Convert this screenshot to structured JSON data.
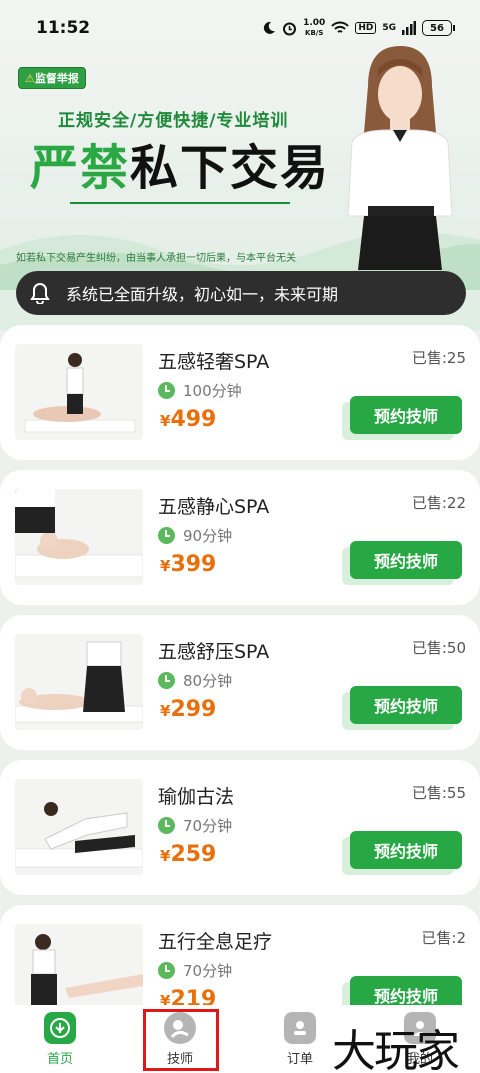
{
  "status_bar": {
    "time": "11:52",
    "net_speed_top": "1.00",
    "net_speed_unit": "KB/S",
    "hd": "HD",
    "signal": "5G",
    "battery": "56"
  },
  "banner": {
    "badge": "监督举报",
    "subtitle": "正规安全/方便快捷/专业培训",
    "title_green": "严禁",
    "title_black": "私下交易",
    "disclaimer": "如若私下交易产生纠纷，由当事人承担一切后果，与本平台无关"
  },
  "notice": {
    "text": "系统已全面升级，初心如一，未来可期",
    "icon": "bell-icon"
  },
  "services": [
    {
      "title": "五感轻奢SPA",
      "sold": "已售:25",
      "duration": "100分钟",
      "currency": "¥",
      "price": "499",
      "button": "预约技师"
    },
    {
      "title": "五感静心SPA",
      "sold": "已售:22",
      "duration": "90分钟",
      "currency": "¥",
      "price": "399",
      "button": "预约技师"
    },
    {
      "title": "五感舒压SPA",
      "sold": "已售:50",
      "duration": "80分钟",
      "currency": "¥",
      "price": "299",
      "button": "预约技师"
    },
    {
      "title": "瑜伽古法",
      "sold": "已售:55",
      "duration": "70分钟",
      "currency": "¥",
      "price": "259",
      "button": "预约技师"
    },
    {
      "title": "五行全息足疗",
      "sold": "已售:2",
      "duration": "70分钟",
      "currency": "¥",
      "price": "219",
      "button": "预约技师"
    }
  ],
  "tabs": [
    {
      "label": "首页",
      "icon": "home-icon"
    },
    {
      "label": "技师",
      "icon": "technician-icon"
    },
    {
      "label": "订单",
      "icon": "order-icon"
    },
    {
      "label": "我的",
      "icon": "profile-icon"
    }
  ],
  "watermark": "大玩家",
  "colors": {
    "accent": "#27a845",
    "price": "#e8700c",
    "highlight": "#e21818"
  }
}
